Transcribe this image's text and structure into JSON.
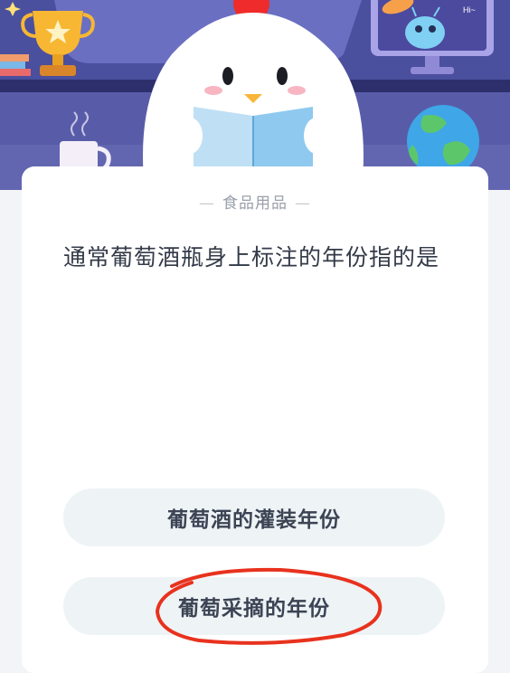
{
  "quiz": {
    "category": "食品用品",
    "category_dash": "—",
    "question": "通常葡萄酒瓶身上标注的年份指的是",
    "options": [
      {
        "label": "葡萄酒的灌装年份"
      },
      {
        "label": "葡萄采摘的年份"
      }
    ]
  },
  "banner": {
    "robot_speech": "Hi~",
    "icons": [
      "trophy-icon",
      "books-icon",
      "mascot-penguin",
      "mug-icon",
      "globe-icon",
      "robot-monitor-icon"
    ]
  },
  "annotation": {
    "circled_option_index": 1,
    "color": "#e8321e"
  },
  "colors": {
    "banner_top": "#3a3f8f",
    "card_bg": "#ffffff",
    "option_bg": "#eef3f6",
    "question_text": "#333a48",
    "category_text": "#9aa1ab"
  }
}
